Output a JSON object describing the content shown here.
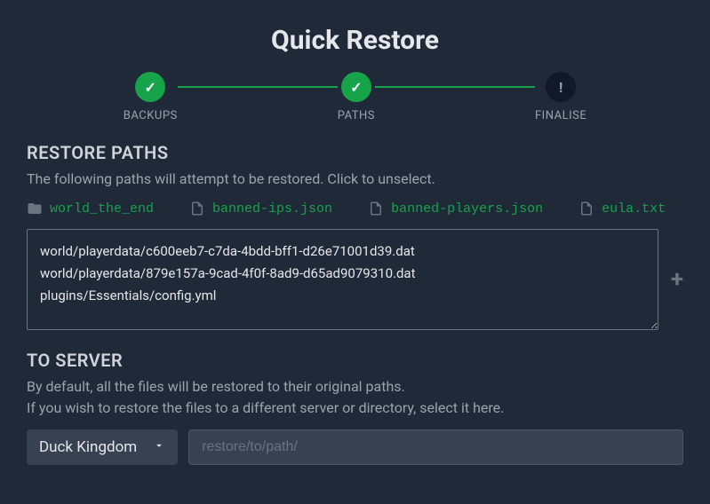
{
  "title": "Quick Restore",
  "stepper": {
    "steps": [
      {
        "label": "BACKUPS",
        "state": "done"
      },
      {
        "label": "PATHS",
        "state": "done"
      },
      {
        "label": "FINALISE",
        "state": "pending"
      }
    ]
  },
  "restore": {
    "heading": "RESTORE PATHS",
    "description": "The following paths will attempt to be restored. Click to unselect.",
    "paths": [
      {
        "name": "world_the_end",
        "type": "folder"
      },
      {
        "name": "banned-ips.json",
        "type": "file"
      },
      {
        "name": "banned-players.json",
        "type": "file"
      },
      {
        "name": "eula.txt",
        "type": "file"
      }
    ],
    "textarea_value": "world/playerdata/c600eeb7-c7da-4bdd-bff1-d26e71001d39.dat\nworld/playerdata/879e157a-9cad-4f0f-8ad9-d65ad9079310.dat\nplugins/Essentials/config.yml",
    "add_label": "+"
  },
  "to_server": {
    "heading": "TO SERVER",
    "description_line1": "By default, all the files will be restored to their original paths.",
    "description_line2": "If you wish to restore the files to a different server or directory, select it here.",
    "selected_server": "Duck Kingdom",
    "path_placeholder": "restore/to/path/",
    "path_value": ""
  }
}
